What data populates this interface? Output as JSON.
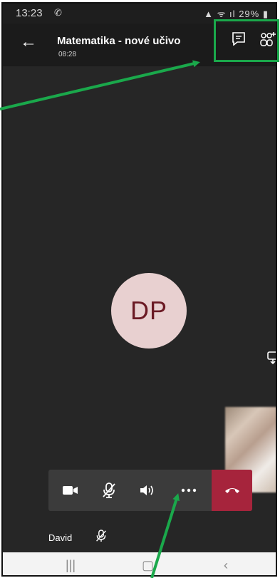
{
  "status_bar": {
    "time": "13:23",
    "battery": "29%"
  },
  "header": {
    "title": "Matematika - nové učivo",
    "elapsed": "08:28"
  },
  "avatar": {
    "initials": "DP"
  },
  "participant": {
    "name": "David"
  },
  "colors": {
    "highlight": "#1aa84b",
    "hangup": "#a6243c",
    "avatar_bg": "#e8d0d0",
    "avatar_text": "#6b1a24"
  },
  "icons": [
    "back-arrow-icon",
    "chat-icon",
    "add-people-icon",
    "switch-camera-icon",
    "video-camera-icon",
    "mic-off-icon",
    "speaker-icon",
    "more-options-icon",
    "hang-up-icon"
  ]
}
